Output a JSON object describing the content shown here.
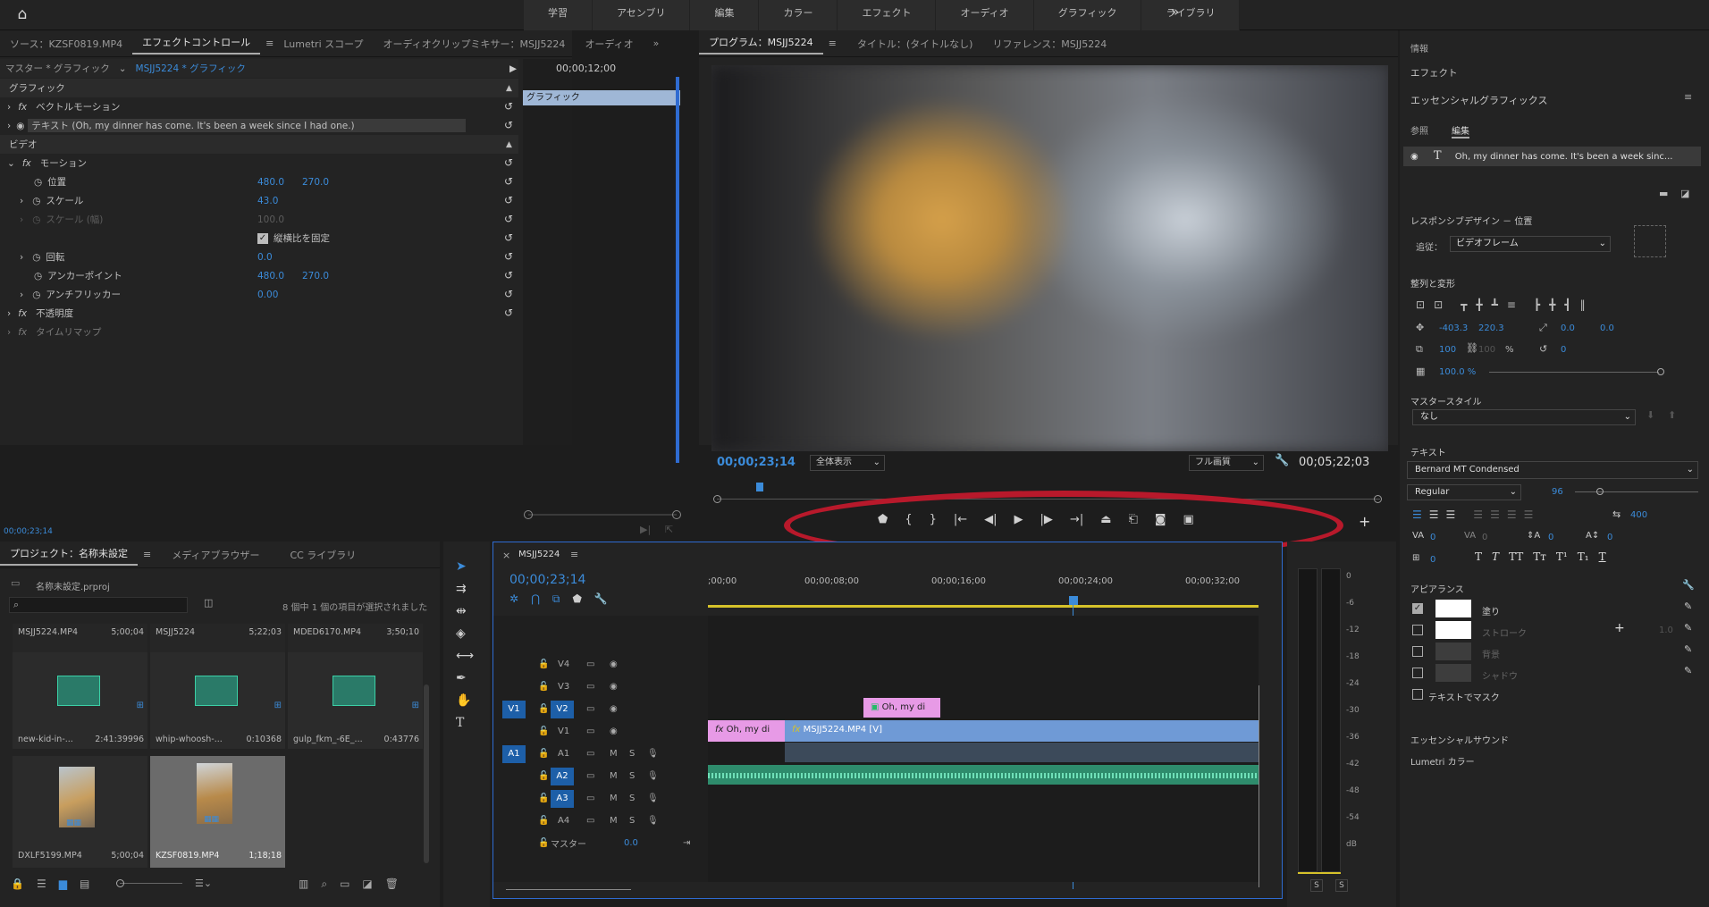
{
  "workspaces": [
    "学習",
    "アセンブリ",
    "編集",
    "カラー",
    "エフェクト",
    "オーディオ",
    "グラフィック",
    "ライブラリ"
  ],
  "ec": {
    "tabs": [
      "ソース：KZSF0819.MP4",
      "エフェクトコントロール",
      "Lumetri スコープ",
      "オーディオクリップミキサー：MSJJ5224",
      "オーディオ"
    ],
    "master": "マスター * グラフィック",
    "clip": "MSJJ5224 * グラフィック",
    "mini_time": "00;00;12;00",
    "mini_clip": "グラフィック",
    "sec_graphic": "グラフィック",
    "vector_motion": "ベクトルモーション",
    "text_layer": "テキスト (Oh, my dinner has come. It's been a week since I had one.)",
    "sec_video": "ビデオ",
    "motion": "モーション",
    "position": "位置",
    "pos_x": "480.0",
    "pos_y": "270.0",
    "scale": "スケール",
    "scale_v": "43.0",
    "scale_w": "スケール (幅)",
    "scale_w_v": "100.0",
    "uniform": "縦横比を固定",
    "rotation": "回転",
    "rotation_v": "0.0",
    "anchor": "アンカーポイント",
    "anchor_x": "480.0",
    "anchor_y": "270.0",
    "antiflicker": "アンチフリッカー",
    "antiflicker_v": "0.00",
    "opacity": "不透明度",
    "timeremap": "タイムリマップ",
    "footer_time": "00;00;23;14"
  },
  "prog": {
    "tabs": [
      "プログラム：MSJJ5224",
      "タイトル：(タイトルなし)",
      "リファレンス：MSJJ5224"
    ],
    "timecode": "00;00;23;14",
    "fit": "全体表示",
    "quality": "フル画質",
    "duration": "00;05;22;03"
  },
  "right": {
    "info": "情報",
    "effects": "エフェクト",
    "eg": "エッセンシャルグラフィックス",
    "tab_browse": "参照",
    "tab_edit": "編集",
    "layer": "Oh, my dinner has come. It's been a week sinc...",
    "responsive": "レスポンシブデザイン － 位置",
    "follow_label": "追従：",
    "follow_value": "ビデオフレーム",
    "align": "整列と変形",
    "pos_x": "-403.3",
    "pos_y": "220.3",
    "anc_x": "0.0",
    "anc_y": "0.0",
    "scale": "100",
    "scale2": "100",
    "pct": "%",
    "rot": "0",
    "opacity": "100.0 %",
    "master_style": "マスタースタイル",
    "master_style_v": "なし",
    "text": "テキスト",
    "font": "Bernard MT Condensed",
    "style": "Regular",
    "size": "96",
    "tracking": "400",
    "kern": "0",
    "track2": "0",
    "lead": "0",
    "base": "0",
    "tsume": "0",
    "appearance": "アピアランス",
    "fill": "塗り",
    "stroke": "ストローク",
    "stroke_w": "1.0",
    "bg": "背景",
    "shadow": "シャドウ",
    "mask": "テキストでマスク",
    "sound": "エッセンシャルサウンド",
    "lumetri": "Lumetri カラー"
  },
  "proj": {
    "tabs": [
      "プロジェクト：名称未設定",
      "メディアブラウザー",
      "CC ライブラリ"
    ],
    "file": "名称未設定.prproj",
    "count": "8 個中 1 個の項目が選択されました",
    "items": [
      {
        "name": "MSJJ5224.MP4",
        "dur": "5;00;04"
      },
      {
        "name": "MSJJ5224",
        "dur": "5;22;03"
      },
      {
        "name": "MDED6170.MP4",
        "dur": "3;50;10"
      },
      {
        "name": "new-kid-in-...",
        "dur": "2:41:39996"
      },
      {
        "name": "whip-whoosh-...",
        "dur": "0:10368"
      },
      {
        "name": "gulp_fkm_-6E_...",
        "dur": "0:43776"
      },
      {
        "name": "DXLF5199.MP4",
        "dur": "5;00;04"
      },
      {
        "name": "KZSF0819.MP4",
        "dur": "1;18;18"
      }
    ]
  },
  "tl": {
    "seq": "MSJJ5224",
    "timecode": "00;00;23;14",
    "ruler": [
      ";00;00",
      "00;00;08;00",
      "00;00;16;00",
      "00;00;24;00",
      "00;00;32;00"
    ],
    "tracks": [
      "V4",
      "V3",
      "V2",
      "V1",
      "A1",
      "A2",
      "A3",
      "A4"
    ],
    "src_v": "V1",
    "src_a": "A1",
    "m": "M",
    "s": "S",
    "master": "マスター",
    "master_v": "0.0",
    "clip_graphic_v2": "Oh, my di",
    "clip_graphic_v1": "Oh, my di",
    "clip_video": "MSJJ5224.MP4 [V]",
    "fx": "fx"
  },
  "meter": {
    "scale": [
      "0",
      "-6",
      "-12",
      "-18",
      "-24",
      "-30",
      "-36",
      "-42",
      "-48",
      "-54",
      "dB"
    ],
    "s1": "S",
    "s2": "S"
  }
}
